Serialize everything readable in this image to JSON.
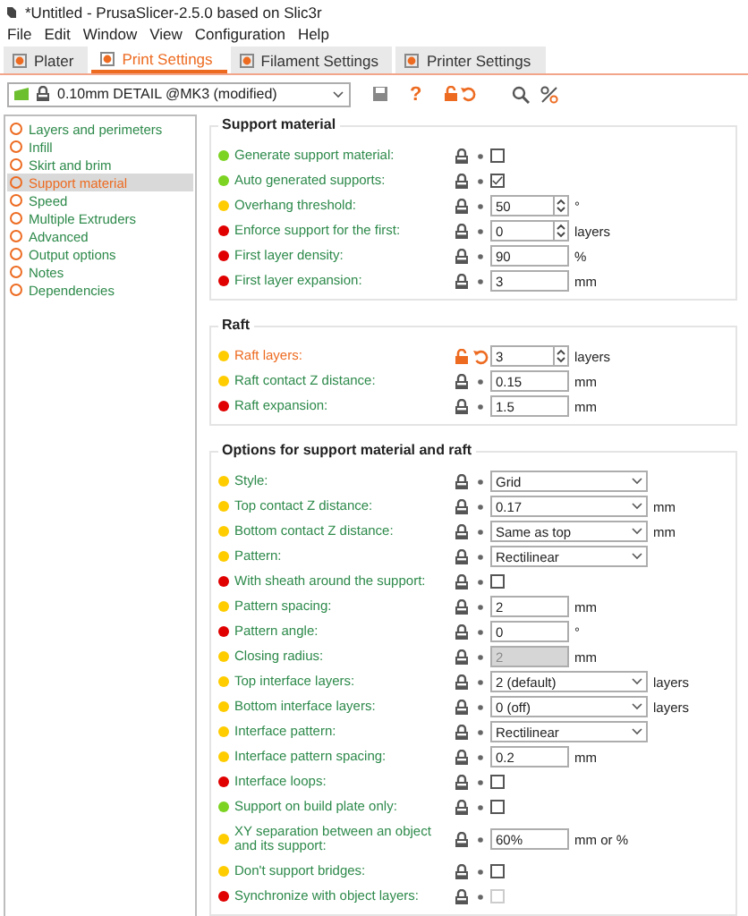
{
  "window": {
    "title": "*Untitled - PrusaSlicer-2.5.0 based on Slic3r"
  },
  "menu": [
    "File",
    "Edit",
    "Window",
    "View",
    "Configuration",
    "Help"
  ],
  "tabs": [
    {
      "label": "Plater",
      "selected": false
    },
    {
      "label": "Print Settings",
      "selected": true
    },
    {
      "label": "Filament Settings",
      "selected": false
    },
    {
      "label": "Printer Settings",
      "selected": false
    }
  ],
  "preset": {
    "value": "0.10mm DETAIL @MK3 (modified)",
    "help": "?"
  },
  "sidebar": [
    {
      "label": "Layers and perimeters",
      "selected": false
    },
    {
      "label": "Infill",
      "selected": false
    },
    {
      "label": "Skirt and brim",
      "selected": false
    },
    {
      "label": "Support material",
      "selected": true
    },
    {
      "label": "Speed",
      "selected": false
    },
    {
      "label": "Multiple Extruders",
      "selected": false
    },
    {
      "label": "Advanced",
      "selected": false
    },
    {
      "label": "Output options",
      "selected": false
    },
    {
      "label": "Notes",
      "selected": false
    },
    {
      "label": "Dependencies",
      "selected": false
    }
  ],
  "groups": [
    {
      "title": "Support material",
      "options": [
        {
          "label": "Generate support material:",
          "color": "#7cd321",
          "kind": "checkbox",
          "checked": false,
          "modified": false,
          "disabled": false
        },
        {
          "label": "Auto generated supports:",
          "color": "#7cd321",
          "kind": "checkbox",
          "checked": true,
          "modified": false,
          "disabled": false
        },
        {
          "label": "Overhang threshold:",
          "color": "#ffcc00",
          "kind": "spin",
          "value": "50",
          "unit": "°",
          "modified": false,
          "disabled": false
        },
        {
          "label": "Enforce support for the first:",
          "color": "#e00000",
          "kind": "spin",
          "value": "0",
          "unit": "layers",
          "modified": false,
          "disabled": false
        },
        {
          "label": "First layer density:",
          "color": "#e00000",
          "kind": "text",
          "value": "90",
          "unit": "%",
          "modified": false,
          "disabled": false
        },
        {
          "label": "First layer expansion:",
          "color": "#e00000",
          "kind": "text",
          "value": "3",
          "unit": "mm",
          "modified": false,
          "disabled": false
        }
      ]
    },
    {
      "title": "Raft",
      "options": [
        {
          "label": "Raft layers:",
          "color": "#ffcc00",
          "kind": "spin",
          "value": "3",
          "unit": "layers",
          "modified": true,
          "disabled": false
        },
        {
          "label": "Raft contact Z distance:",
          "color": "#ffcc00",
          "kind": "text",
          "value": "0.15",
          "unit": "mm",
          "modified": false,
          "disabled": false
        },
        {
          "label": "Raft expansion:",
          "color": "#e00000",
          "kind": "text",
          "value": "1.5",
          "unit": "mm",
          "modified": false,
          "disabled": false
        }
      ]
    },
    {
      "title": "Options for support material and raft",
      "options": [
        {
          "label": "Style:",
          "color": "#ffcc00",
          "kind": "combo",
          "value": "Grid",
          "modified": false,
          "disabled": false
        },
        {
          "label": "Top contact Z distance:",
          "color": "#ffcc00",
          "kind": "combo",
          "value": "0.17",
          "unit": "mm",
          "modified": false,
          "disabled": false
        },
        {
          "label": "Bottom contact Z distance:",
          "color": "#ffcc00",
          "kind": "combo",
          "value": "Same as top",
          "unit": "mm",
          "modified": false,
          "disabled": false
        },
        {
          "label": "Pattern:",
          "color": "#ffcc00",
          "kind": "combo",
          "value": "Rectilinear",
          "modified": false,
          "disabled": false
        },
        {
          "label": "With sheath around the support:",
          "color": "#e00000",
          "kind": "checkbox",
          "checked": false,
          "modified": false,
          "disabled": false
        },
        {
          "label": "Pattern spacing:",
          "color": "#ffcc00",
          "kind": "text",
          "value": "2",
          "unit": "mm",
          "modified": false,
          "disabled": false
        },
        {
          "label": "Pattern angle:",
          "color": "#e00000",
          "kind": "text",
          "value": "0",
          "unit": "°",
          "modified": false,
          "disabled": false
        },
        {
          "label": "Closing radius:",
          "color": "#ffcc00",
          "kind": "text",
          "value": "2",
          "unit": "mm",
          "modified": false,
          "disabled": true
        },
        {
          "label": "Top interface layers:",
          "color": "#ffcc00",
          "kind": "combo",
          "value": "2 (default)",
          "unit": "layers",
          "modified": false,
          "disabled": false
        },
        {
          "label": "Bottom interface layers:",
          "color": "#ffcc00",
          "kind": "combo",
          "value": "0 (off)",
          "unit": "layers",
          "modified": false,
          "disabled": false
        },
        {
          "label": "Interface pattern:",
          "color": "#ffcc00",
          "kind": "combo",
          "value": "Rectilinear",
          "modified": false,
          "disabled": false
        },
        {
          "label": "Interface pattern spacing:",
          "color": "#ffcc00",
          "kind": "text",
          "value": "0.2",
          "unit": "mm",
          "modified": false,
          "disabled": false
        },
        {
          "label": "Interface loops:",
          "color": "#e00000",
          "kind": "checkbox",
          "checked": false,
          "modified": false,
          "disabled": false
        },
        {
          "label": "Support on build plate only:",
          "color": "#7cd321",
          "kind": "checkbox",
          "checked": false,
          "modified": false,
          "disabled": false
        },
        {
          "label": "XY separation between an object and its support:",
          "color": "#ffcc00",
          "kind": "text",
          "value": "60%",
          "unit": "mm or %",
          "modified": false,
          "disabled": false
        },
        {
          "label": "Don't support bridges:",
          "color": "#ffcc00",
          "kind": "checkbox",
          "checked": false,
          "modified": false,
          "disabled": false
        },
        {
          "label": "Synchronize with object layers:",
          "color": "#e00000",
          "kind": "checkbox",
          "checked": false,
          "modified": false,
          "disabled": true
        }
      ]
    }
  ]
}
